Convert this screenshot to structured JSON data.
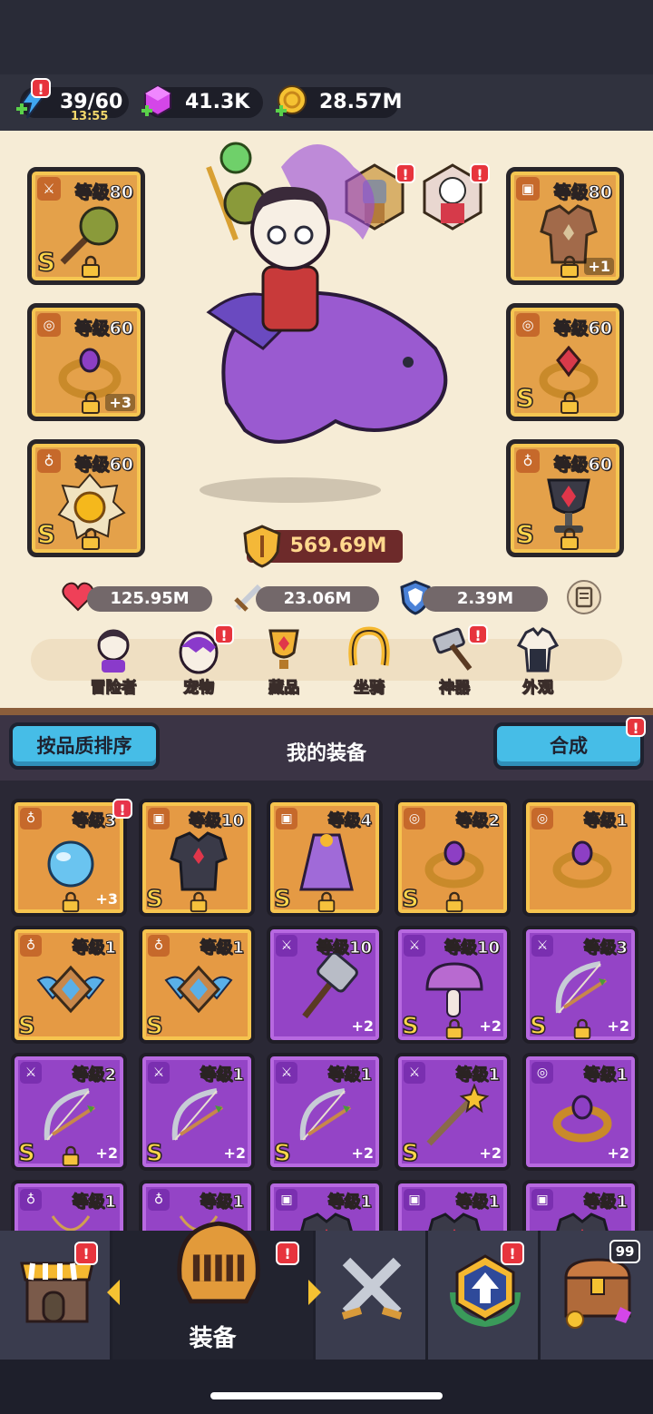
{
  "resources": {
    "energy": {
      "value": "39/60",
      "timer": "13:55",
      "icon": "energy-icon"
    },
    "gems": {
      "value": "41.3K",
      "icon": "gem-icon"
    },
    "gold": {
      "value": "28.57M",
      "icon": "gold-icon"
    }
  },
  "hero": {
    "left_slots": [
      {
        "level": "等级80",
        "grade": "S",
        "plus": "",
        "icon": "mace-icon",
        "category": "weapon"
      },
      {
        "level": "等级60",
        "grade": "",
        "plus": "+3",
        "icon": "ring-icon",
        "category": "ring"
      },
      {
        "level": "等级60",
        "grade": "S",
        "plus": "",
        "icon": "medal-icon",
        "category": "necklace"
      }
    ],
    "right_slots": [
      {
        "level": "等级80",
        "grade": "",
        "plus": "+1",
        "icon": "armor-icon",
        "category": "armor"
      },
      {
        "level": "等级60",
        "grade": "S",
        "plus": "",
        "icon": "ring-icon",
        "category": "ring"
      },
      {
        "level": "等级60",
        "grade": "S",
        "plus": "",
        "icon": "chalice-icon",
        "category": "necklace"
      }
    ],
    "power": "569.69M",
    "hp": "125.95M",
    "attack": "23.06M",
    "defense": "2.39M"
  },
  "hero_menu": [
    "冒险者",
    "宠物",
    "藏品",
    "坐骑",
    "神器",
    "外观"
  ],
  "equipment": {
    "sort_button": "按品质排序",
    "title": "我的装备",
    "merge_button": "合成",
    "items": [
      {
        "level": "等级3",
        "rarity": "o",
        "grade": "",
        "plus": "+3",
        "lock": true,
        "icon": "orb-icon"
      },
      {
        "level": "等级10",
        "rarity": "o",
        "grade": "S",
        "plus": "",
        "lock": true,
        "icon": "armor-icon"
      },
      {
        "level": "等级4",
        "rarity": "o",
        "grade": "S",
        "plus": "",
        "lock": true,
        "icon": "cape-icon"
      },
      {
        "level": "等级2",
        "rarity": "o",
        "grade": "S",
        "plus": "",
        "lock": true,
        "icon": "ring-icon"
      },
      {
        "level": "等级1",
        "rarity": "o",
        "grade": "",
        "plus": "",
        "lock": false,
        "icon": "ring-icon"
      },
      {
        "level": "等级1",
        "rarity": "o",
        "grade": "S",
        "plus": "",
        "lock": false,
        "icon": "wing-icon"
      },
      {
        "level": "等级1",
        "rarity": "o",
        "grade": "S",
        "plus": "",
        "lock": false,
        "icon": "wing-icon"
      },
      {
        "level": "等级10",
        "rarity": "p",
        "grade": "",
        "plus": "+2",
        "lock": false,
        "icon": "hammer-icon"
      },
      {
        "level": "等级10",
        "rarity": "p",
        "grade": "S",
        "plus": "+2",
        "lock": true,
        "icon": "mushroom-icon"
      },
      {
        "level": "等级3",
        "rarity": "p",
        "grade": "S",
        "plus": "+2",
        "lock": true,
        "icon": "bow-icon"
      },
      {
        "level": "等级2",
        "rarity": "p",
        "grade": "S",
        "plus": "+2",
        "lock": true,
        "icon": "bow-icon"
      },
      {
        "level": "等级1",
        "rarity": "p",
        "grade": "S",
        "plus": "+2",
        "lock": false,
        "icon": "bow-icon"
      },
      {
        "level": "等级1",
        "rarity": "p",
        "grade": "S",
        "plus": "+2",
        "lock": false,
        "icon": "bow-icon"
      },
      {
        "level": "等级1",
        "rarity": "p",
        "grade": "S",
        "plus": "+2",
        "lock": false,
        "icon": "staff-icon"
      },
      {
        "level": "等级1",
        "rarity": "p",
        "grade": "",
        "plus": "+2",
        "lock": false,
        "icon": "ring-icon"
      },
      {
        "level": "等级1",
        "rarity": "p",
        "grade": "",
        "plus": "",
        "lock": false,
        "icon": "amulet-icon"
      },
      {
        "level": "等级1",
        "rarity": "p",
        "grade": "",
        "plus": "",
        "lock": false,
        "icon": "amulet-icon"
      },
      {
        "level": "等级1",
        "rarity": "p",
        "grade": "",
        "plus": "",
        "lock": false,
        "icon": "armor-icon"
      },
      {
        "level": "等级1",
        "rarity": "p",
        "grade": "",
        "plus": "",
        "lock": false,
        "icon": "armor-icon"
      },
      {
        "level": "等级1",
        "rarity": "p",
        "grade": "",
        "plus": "",
        "lock": false,
        "icon": "armor-icon"
      }
    ]
  },
  "tabs": {
    "active_label": "装备",
    "chest_count": "99"
  }
}
